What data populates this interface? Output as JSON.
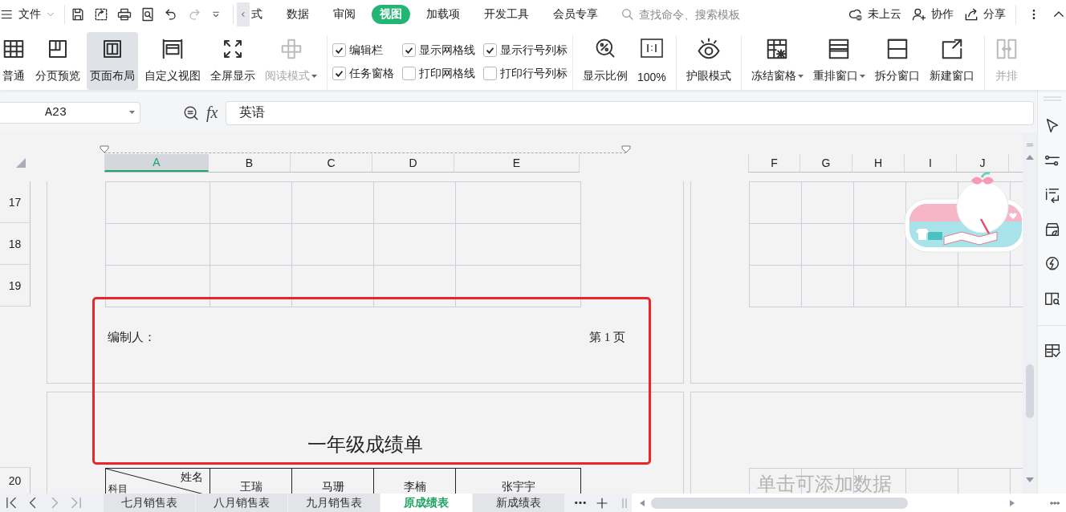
{
  "top_bar": {
    "file_menu": "文件",
    "tabs": [
      {
        "label": "式",
        "selected": false
      },
      {
        "label": "数据",
        "selected": false
      },
      {
        "label": "审阅",
        "selected": false
      },
      {
        "label": "视图",
        "selected": true
      },
      {
        "label": "加载项",
        "selected": false
      },
      {
        "label": "开发工具",
        "selected": false
      },
      {
        "label": "会员专享",
        "selected": false
      }
    ],
    "search": {
      "placeholder": "查找命令、搜索模板"
    },
    "actions": [
      "未上云",
      "协作",
      "分享"
    ]
  },
  "ribbon": {
    "view_buttons": [
      {
        "label": "普通",
        "selected": false,
        "disabled": false,
        "dropdown": false
      },
      {
        "label": "分页预览",
        "selected": false,
        "disabled": false,
        "dropdown": false
      },
      {
        "label": "页面布局",
        "selected": true,
        "disabled": false,
        "dropdown": false
      },
      {
        "label": "自定义视图",
        "selected": false,
        "disabled": false,
        "dropdown": false
      },
      {
        "label": "全屏显示",
        "selected": false,
        "disabled": false,
        "dropdown": false
      },
      {
        "label": "阅读模式",
        "selected": false,
        "disabled": true,
        "dropdown": true
      }
    ],
    "checkboxes": [
      {
        "label": "编辑栏",
        "checked": true
      },
      {
        "label": "任务窗格",
        "checked": true
      },
      {
        "label": "显示网格线",
        "checked": true
      },
      {
        "label": "打印网格线",
        "checked": false
      },
      {
        "label": "显示行号列标",
        "checked": true
      },
      {
        "label": "打印行号列标",
        "checked": false
      }
    ],
    "zoom_buttons": [
      "显示比例",
      "100%"
    ],
    "eye_mode": "护眼模式",
    "window_buttons": [
      {
        "label": "冻结窗格",
        "dropdown": true,
        "disabled": false
      },
      {
        "label": "重排窗口",
        "dropdown": true,
        "disabled": false
      },
      {
        "label": "拆分窗口",
        "dropdown": false,
        "disabled": false
      },
      {
        "label": "新建窗口",
        "dropdown": false,
        "disabled": false
      },
      {
        "label": "并排",
        "dropdown": false,
        "disabled": true
      }
    ]
  },
  "formula_bar": {
    "name_box": "A23",
    "function_label": "fx",
    "value": "英语"
  },
  "sheet": {
    "page_columns": [
      {
        "label": "A",
        "selected": true
      },
      {
        "label": "B",
        "selected": false
      },
      {
        "label": "C",
        "selected": false
      },
      {
        "label": "D",
        "selected": false
      },
      {
        "label": "E",
        "selected": false
      }
    ],
    "right_columns": [
      "F",
      "G",
      "H",
      "I",
      "J"
    ],
    "rows": [
      "17",
      "18",
      "19"
    ],
    "footer_left": "编制人：",
    "footer_right": "第 1 页",
    "page_title": "一年级成绩单",
    "row_20": {
      "number": "20",
      "header_top": "姓名",
      "header_bottom": "科目",
      "names": [
        "王瑞",
        "马珊",
        "李楠",
        "张宇宇"
      ]
    },
    "hint": "单击可添加数据"
  },
  "sheet_tabs": [
    {
      "label": "七月销售表",
      "selected": false
    },
    {
      "label": "八月销售表",
      "selected": false
    },
    {
      "label": "九月销售表",
      "selected": false
    },
    {
      "label": "原成绩表",
      "selected": true
    },
    {
      "label": "新成绩表",
      "selected": false
    }
  ]
}
